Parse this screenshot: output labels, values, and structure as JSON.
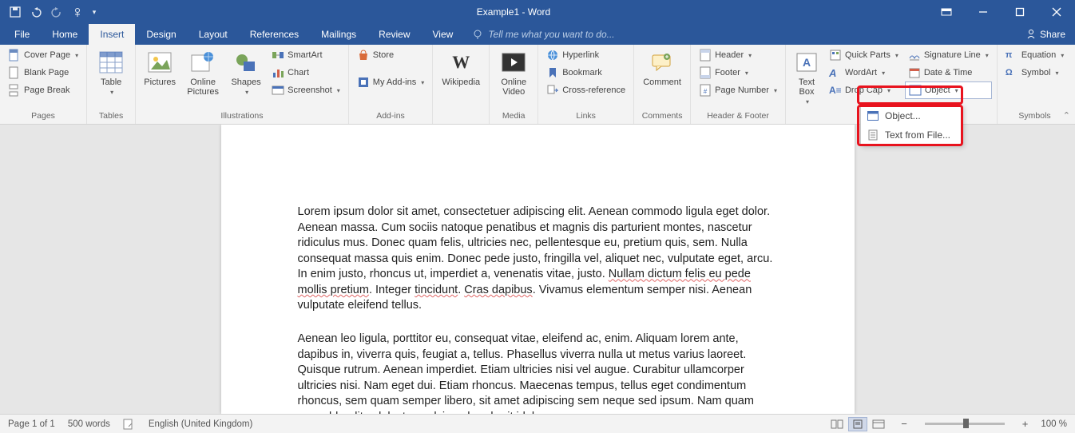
{
  "title": "Example1 - Word",
  "tabs": [
    "File",
    "Home",
    "Insert",
    "Design",
    "Layout",
    "References",
    "Mailings",
    "Review",
    "View"
  ],
  "active_tab": "Insert",
  "tellme_placeholder": "Tell me what you want to do...",
  "share": "Share",
  "groups": {
    "pages": {
      "label": "Pages",
      "cover": "Cover Page",
      "blank": "Blank Page",
      "break": "Page Break"
    },
    "tables": {
      "label": "Tables",
      "table": "Table"
    },
    "illustrations": {
      "label": "Illustrations",
      "pictures": "Pictures",
      "online": "Online Pictures",
      "shapes": "Shapes",
      "smartart": "SmartArt",
      "chart": "Chart",
      "screenshot": "Screenshot"
    },
    "addins": {
      "label": "Add-ins",
      "store": "Store",
      "myaddins": "My Add-ins"
    },
    "wikipedia": "Wikipedia",
    "media": {
      "label": "Media",
      "video": "Online Video"
    },
    "links": {
      "label": "Links",
      "hyperlink": "Hyperlink",
      "bookmark": "Bookmark",
      "crossref": "Cross-reference"
    },
    "comments": {
      "label": "Comments",
      "comment": "Comment"
    },
    "headerfooter": {
      "label": "Header & Footer",
      "header": "Header",
      "footer": "Footer",
      "pagenum": "Page Number"
    },
    "text": {
      "label": "Text",
      "textbox": "Text Box",
      "quickparts": "Quick Parts",
      "wordart": "WordArt",
      "dropcap": "Drop Cap",
      "sigline": "Signature Line",
      "datetime": "Date & Time",
      "object": "Object"
    },
    "symbols": {
      "label": "Symbols",
      "equation": "Equation",
      "symbol": "Symbol"
    }
  },
  "object_menu": {
    "object": "Object...",
    "textfile": "Text from File..."
  },
  "document": {
    "p1": "Lorem ipsum dolor sit amet, consectetuer adipiscing elit. Aenean commodo ligula eget dolor. Aenean massa. Cum sociis natoque penatibus et magnis dis parturient montes, nascetur ridiculus mus. Donec quam felis, ultricies nec, pellentesque eu, pretium quis, sem. Nulla consequat massa quis enim. Donec pede justo, fringilla vel, aliquet nec, vulputate eget, arcu. In enim justo, rhoncus ut, imperdiet a, venenatis vitae, justo. ",
    "p1_wave": "Nullam dictum felis eu pede mollis pretium",
    "p1_mid": ". Integer ",
    "p1_wave2": "tincidunt",
    "p1_mid2": ". ",
    "p1_wave3": "Cras dapibus",
    "p1_end": ". Vivamus elementum semper nisi. Aenean vulputate eleifend tellus.",
    "p2": "Aenean leo ligula, porttitor eu, consequat vitae, eleifend ac, enim. Aliquam lorem ante, dapibus in, viverra quis, feugiat a, tellus. Phasellus viverra nulla ut metus varius laoreet. Quisque rutrum. Aenean imperdiet. Etiam ultricies nisi vel augue. Curabitur ullamcorper ultricies nisi. Nam eget dui. Etiam rhoncus. Maecenas tempus, tellus eget condimentum rhoncus, sem quam semper libero, sit amet adipiscing sem neque sed ipsum. Nam quam nunc, blandit vel, luctus pulvinar, hendrerit id, lorem."
  },
  "status": {
    "page": "Page 1 of 1",
    "words": "500 words",
    "lang": "English (United Kingdom)",
    "zoom": "100 %"
  }
}
